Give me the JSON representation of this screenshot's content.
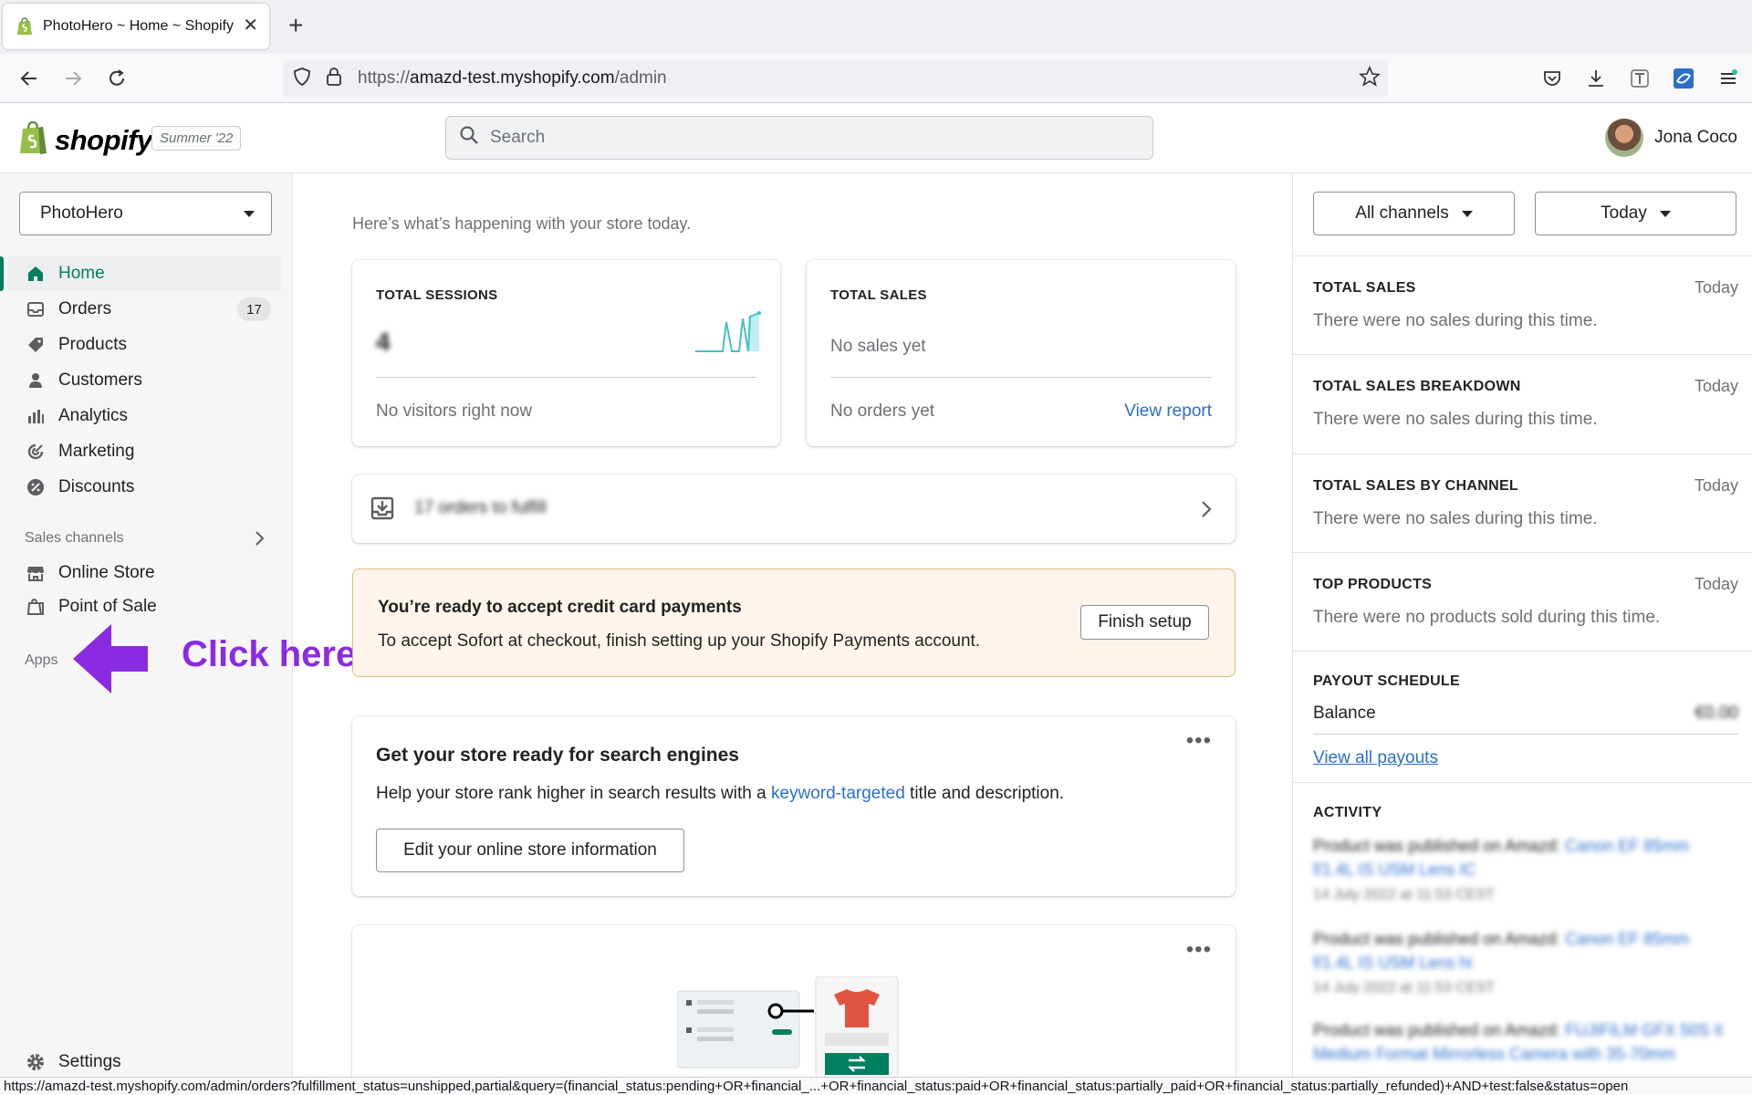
{
  "browser": {
    "tab_title": "PhotoHero ~ Home ~ Shopify",
    "url_prefix": "https://",
    "url_host": "amazd-test.myshopify.com",
    "url_path": "/admin",
    "status_url": "https://amazd-test.myshopify.com/admin/orders?fulfillment_status=unshipped,partial&query=(financial_status:pending+OR+financial_...+OR+financial_status:paid+OR+financial_status:partially_paid+OR+financial_status:partially_refunded)+AND+test:false&status=open"
  },
  "topbar": {
    "logo_text": "shopify",
    "edition": "Summer '22",
    "search_placeholder": "Search",
    "user_name": "Jona Coco"
  },
  "sidebar": {
    "store_name": "PhotoHero",
    "items": [
      {
        "label": "Home",
        "icon": "home-icon",
        "active": true
      },
      {
        "label": "Orders",
        "icon": "orders-icon",
        "badge": "17"
      },
      {
        "label": "Products",
        "icon": "tag-icon"
      },
      {
        "label": "Customers",
        "icon": "person-icon"
      },
      {
        "label": "Analytics",
        "icon": "bar-chart-icon"
      },
      {
        "label": "Marketing",
        "icon": "target-icon"
      },
      {
        "label": "Discounts",
        "icon": "discount-icon"
      }
    ],
    "sales_channels_title": "Sales channels",
    "channels": [
      {
        "label": "Online Store",
        "icon": "store-icon"
      },
      {
        "label": "Point of Sale",
        "icon": "pos-bag-icon"
      }
    ],
    "apps_title": "Apps",
    "settings_label": "Settings",
    "annotation": "Click here"
  },
  "main": {
    "intro": "Here’s what’s happening with your store today.",
    "sessions": {
      "title": "TOTAL SESSIONS",
      "value": "4",
      "footer": "No visitors right now"
    },
    "sales": {
      "title": "TOTAL SALES",
      "value": "No sales yet",
      "footer": "No orders yet",
      "link": "View report"
    },
    "orders_to_fulfill": "17 orders to fulfill",
    "banner": {
      "title": "You’re ready to accept credit card payments",
      "body": "To accept Sofort at checkout, finish setting up your Shopify Payments account.",
      "button": "Finish setup"
    },
    "seo": {
      "title": "Get your store ready for search engines",
      "body_pre": "Help your store rank higher in search results with a ",
      "body_link": "keyword-targeted",
      "body_post": " title and description.",
      "button": "Edit your online store information"
    }
  },
  "right": {
    "channels_filter": "All channels",
    "date_filter": "Today",
    "sections": [
      {
        "title": "TOTAL SALES",
        "when": "Today",
        "body": "There were no sales during this time."
      },
      {
        "title": "TOTAL SALES BREAKDOWN",
        "when": "Today",
        "body": "There were no sales during this time."
      },
      {
        "title": "TOTAL SALES BY CHANNEL",
        "when": "Today",
        "body": "There were no sales during this time."
      },
      {
        "title": "TOP PRODUCTS",
        "when": "Today",
        "body": "There were no products sold during this time."
      }
    ],
    "payout": {
      "title": "PAYOUT SCHEDULE",
      "balance_label": "Balance",
      "balance_value": "€0.00",
      "link": "View all payouts"
    },
    "activity": {
      "title": "ACTIVITY",
      "entries": [
        {
          "text": "Product was published on Amazd:",
          "product": "Canon EF 85mm f/1.4L IS USM Lens IC",
          "time": "14 July 2022 at 11:53 CEST"
        },
        {
          "text": "Product was published on Amazd:",
          "product": "Canon EF 85mm f/1.4L IS USM Lens hi",
          "time": "14 July 2022 at 11:53 CEST"
        },
        {
          "text": "Product was published on Amazd:",
          "product": "FUJIFILM GFX 50S II Medium Format Mirrorless Camera with 35-70mm",
          "time": ""
        }
      ]
    }
  }
}
